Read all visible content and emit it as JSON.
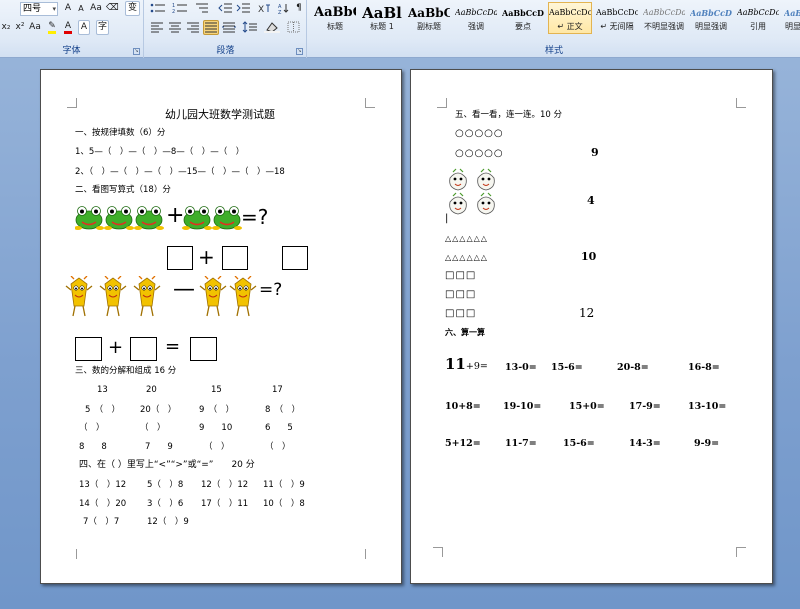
{
  "ribbon": {
    "font_group": {
      "label": "字体",
      "size_value": "四号",
      "row1": [
        "A",
        "A",
        "Aa",
        "⌫",
        "变"
      ],
      "row2": [
        "x₂",
        "x²",
        "Aa",
        "A",
        "A",
        "A",
        "字"
      ]
    },
    "paragraph_group": {
      "label": "段落"
    },
    "styles_group": {
      "label": "样式",
      "tiles": [
        {
          "sample": "AaBbC",
          "name": "标题"
        },
        {
          "sample": "AaBl",
          "name": "标题 1"
        },
        {
          "sample": "AaBbC",
          "name": "副标题"
        },
        {
          "sample": "AaBbCcDd",
          "name": "强调"
        },
        {
          "sample": "AaBbCcD",
          "name": "要点"
        },
        {
          "sample": "AaBbCcDc",
          "name": "↵ 正文"
        },
        {
          "sample": "AaBbCcDc",
          "name": "↵ 无间隔"
        },
        {
          "sample": "AaBbCcDd",
          "name": "不明显强调"
        },
        {
          "sample": "AaBbCcDd",
          "name": "明显强调"
        },
        {
          "sample": "AaBbCcDc",
          "name": "引用"
        },
        {
          "sample": "AaBbCcD",
          "name": "明显"
        }
      ]
    }
  },
  "page1": {
    "title": "幼儿园大班数学测试题",
    "sec1_heading": "一、按规律填数（6）分",
    "sec1_line1": "1、5—（　）—（　）—8—（　）—（　）",
    "sec1_line2": "2、（　）—（　）—（　）—15—（　）—（　）—18",
    "sec2_heading": "二、看图写算式（18）分",
    "eq_sign": "=?",
    "plus": "+",
    "minus": "—",
    "equals": "=",
    "sec3_heading": "三、数的分解和组成 16 分",
    "sec3_top": [
      "13",
      "20",
      "15",
      "17"
    ],
    "sec3_row1": [
      "5　（　）",
      "20（　）",
      "9　（　）",
      "8　（　）"
    ],
    "sec3_row2": [
      "（　）",
      "（　）",
      "9　　10",
      "6　　5"
    ],
    "sec3_row3": [
      "8　　8",
      "7　　9",
      "（　）",
      "（　）"
    ],
    "sec4_heading": "四、在（ ）里写上“<”“>”或“=”　　20 分",
    "sec4_row1": [
      "13（　）12",
      "5（　）8",
      "12（　）12",
      "11（　）9"
    ],
    "sec4_row2": [
      "14（　）20",
      "3（　）6",
      "17（　）11",
      "10（　）8"
    ],
    "sec4_row3": [
      "7（　）7",
      "12（　）9"
    ]
  },
  "page2": {
    "sec5_heading": "五、看一看，连一连。10 分",
    "circles_row": "○○○○○",
    "triangles_row": "△△△△△△",
    "squares_row": "□□□",
    "numbers": [
      "9",
      "4",
      "10",
      "12"
    ],
    "sec6_heading": "六、算一算",
    "calc_row1": [
      "11+9=",
      "13-0=",
      "15-6=",
      "20-8=",
      "16-8="
    ],
    "calc_row2": [
      "10+8=",
      "19-10=",
      "15+0=",
      "17-9=",
      "13-10="
    ],
    "calc_row3": [
      "5+12=",
      "11-7=",
      "15-6=",
      "14-3=",
      "9-9="
    ]
  },
  "colors": {
    "ribbon_bg": "#dfe9f6",
    "workspace_bg": "#7ea0cf",
    "frog_green": "#3fae2a",
    "character_yellow": "#f2c200"
  }
}
